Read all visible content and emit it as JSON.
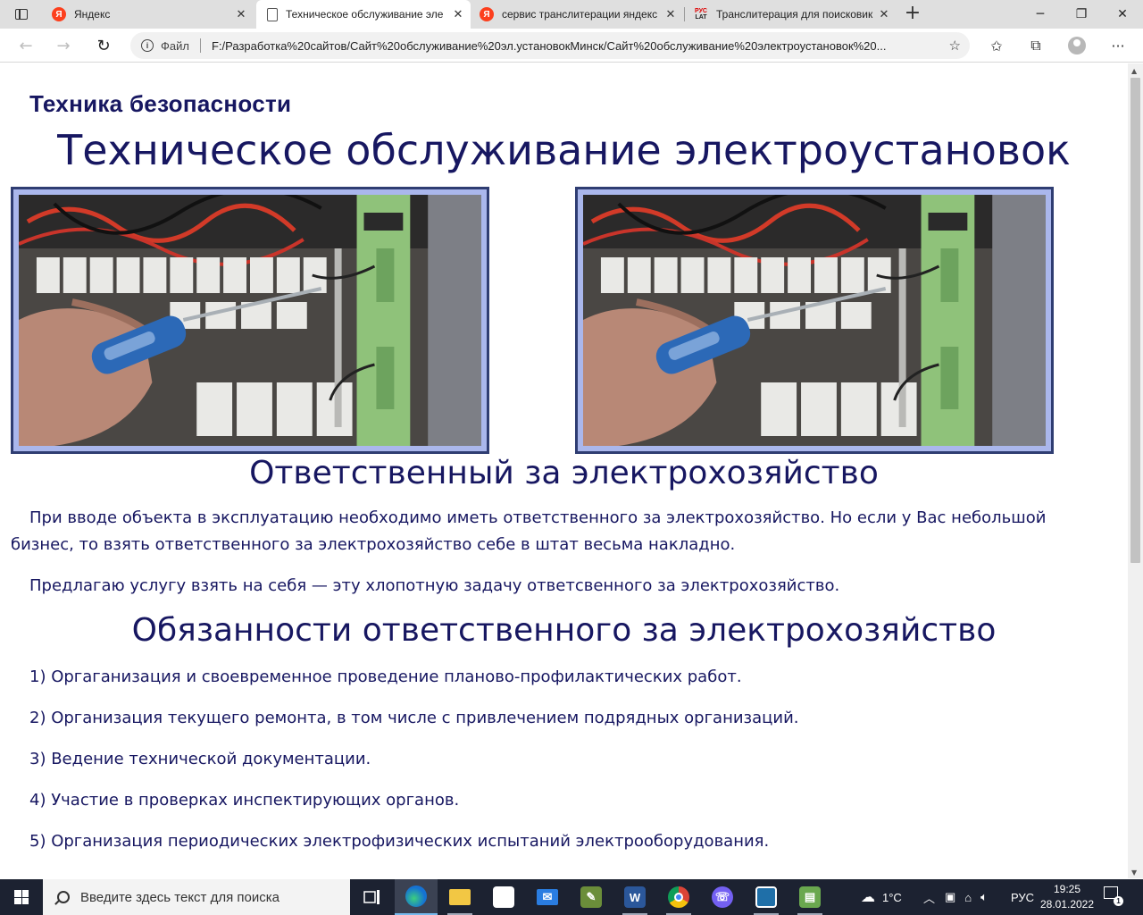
{
  "browser": {
    "tabs": [
      {
        "title": "Яндекс",
        "favicon": "yandex-icon",
        "active": false
      },
      {
        "title": "Техническое обслуживание эле",
        "favicon": "document-icon",
        "active": true
      },
      {
        "title": "сервис транслитерации яндекс",
        "favicon": "yandex-icon",
        "active": false
      },
      {
        "title": "Транслитерация для поисковик",
        "favicon": "rus-lat-icon",
        "active": false
      }
    ],
    "address": {
      "scheme_label": "Файл",
      "url": "F:/Разработка%20сайтов/Сайт%20обслуживание%20эл.установокМинск/Сайт%20обслуживание%20электроустановок%20..."
    },
    "favicon_text": {
      "ya": "Я",
      "rus": "РУС",
      "lat": "LAT"
    }
  },
  "page": {
    "kicker": "Техника безопасности",
    "title": "Техническое обслуживание электроустановок",
    "section1": {
      "heading": "Ответственный за электрохозяйство",
      "paragraphs": [
        "При вводе объекта в эксплуатацию необходимо иметь ответственного за электрохозяйство. Но если у Вас небольшой бизнес, то взять ответственного за электрохозяйство себе в штат весьма накладно.",
        "Предлагаю услугу взять на себя — эту хлопотную задачу ответсвенного за электрохозяйство."
      ]
    },
    "section2": {
      "heading": "Обязанности ответственного за электрохозяйство",
      "items": [
        "1) Оргаганизация и своевременное проведение планово-профилактических работ.",
        "2) Организация текущего ремонта, в том числе с привлечением подрядных организаций.",
        "3) Ведение технической документации.",
        "4) Участие в проверках инспектирующих органов.",
        "5) Организация периодических электрофизических испытаний электрооборудования."
      ]
    },
    "colors": {
      "heading": "#171761",
      "frame_border": "#2f3d72",
      "frame_fill": "#aab7ec"
    }
  },
  "taskbar": {
    "search_placeholder": "Введите здесь текст для поиска",
    "weather": "1°C",
    "language": "РУС",
    "time": "19:25",
    "date": "28.01.2022",
    "notification_count": "1",
    "apps": [
      "task-view-icon",
      "edge-icon",
      "file-explorer-icon",
      "store-icon",
      "mail-icon",
      "app-icon",
      "word-icon",
      "chrome-icon",
      "viber-icon",
      "app-icon",
      "spreadsheet-icon"
    ]
  }
}
